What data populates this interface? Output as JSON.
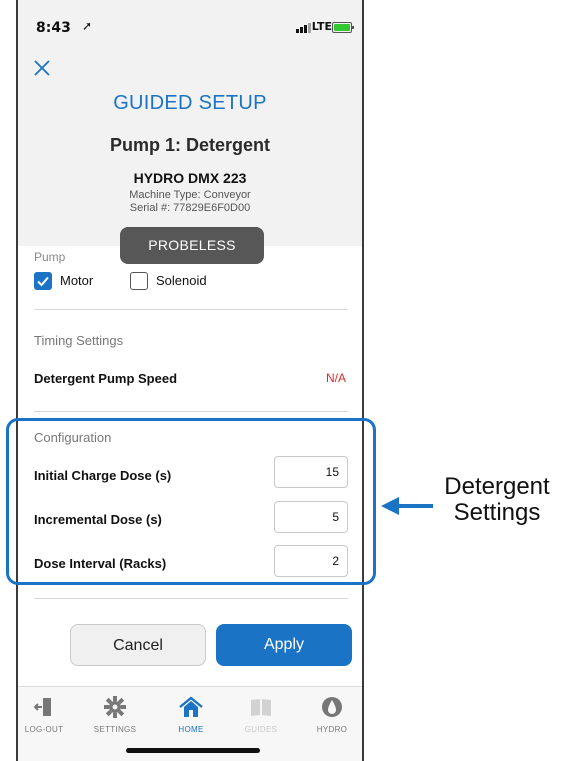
{
  "status_bar": {
    "time": "8:43",
    "location_glyph": "➚",
    "network": "LTE"
  },
  "header": {
    "title": "GUIDED SETUP",
    "pump_name": "Pump 1: Detergent"
  },
  "machine": {
    "model": "HYDRO DMX 223",
    "type": "Machine Type: Conveyor",
    "serial": "Serial #: 77829E6F0D00"
  },
  "probe_badge": "PROBELESS",
  "pump": {
    "label": "Pump",
    "options": [
      {
        "label": "Motor",
        "checked": true
      },
      {
        "label": "Solenoid",
        "checked": false
      }
    ]
  },
  "timing": {
    "section": "Timing Settings",
    "pump_speed_label": "Detergent Pump Speed",
    "pump_speed_value": "N/A"
  },
  "configuration": {
    "section": "Configuration",
    "fields": [
      {
        "label": "Initial Charge Dose (s)",
        "value": "15"
      },
      {
        "label": "Incremental Dose (s)",
        "value": "5"
      },
      {
        "label": "Dose Interval (Racks)",
        "value": "2"
      }
    ]
  },
  "actions": {
    "cancel": "Cancel",
    "apply": "Apply"
  },
  "tabbar": [
    {
      "label": "LOG-OUT",
      "icon": "logout-icon",
      "active": false
    },
    {
      "label": "SETTINGS",
      "icon": "gear-icon",
      "active": false
    },
    {
      "label": "HOME",
      "icon": "home-icon",
      "active": true
    },
    {
      "label": "GUIDES",
      "icon": "book-icon",
      "active": false
    },
    {
      "label": "HYDRO",
      "icon": "hydro-logo-icon",
      "active": false
    }
  ],
  "annotation": {
    "line1": "Detergent",
    "line2": "Settings"
  },
  "colors": {
    "accent": "#1a73c5",
    "alert": "#d92b2b",
    "badge": "#575757"
  }
}
